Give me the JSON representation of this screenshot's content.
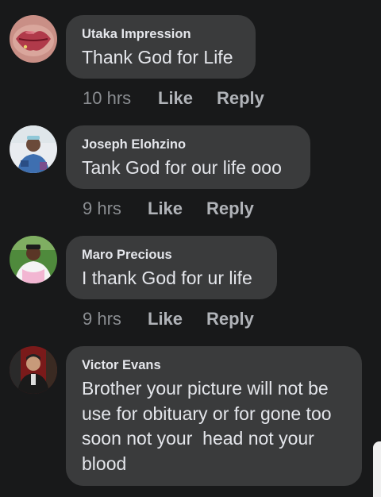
{
  "comments": [
    {
      "author": "Utaka Impression",
      "text": "Thank God for Life",
      "time": "10 hrs",
      "like_label": "Like",
      "reply_label": "Reply",
      "avatar_icon": "lips-photo-avatar"
    },
    {
      "author": "Joseph Elohzino",
      "text": "Tank God for our life ooo",
      "time": "9 hrs",
      "like_label": "Like",
      "reply_label": "Reply",
      "avatar_icon": "person-photo-avatar"
    },
    {
      "author": "Maro Precious",
      "text": "I thank God for ur life",
      "time": "9 hrs",
      "like_label": "Like",
      "reply_label": "Reply",
      "avatar_icon": "person-photo-avatar"
    },
    {
      "author": "Victor Evans",
      "text": "Brother your picture will not be use for obituary or for gone too soon not your  head not your blood",
      "avatar_icon": "person-photo-avatar"
    }
  ],
  "colors": {
    "background": "#18191a",
    "bubble": "#3a3b3c",
    "primary_text": "#e4e6eb",
    "secondary_text": "#b0b3b8"
  }
}
